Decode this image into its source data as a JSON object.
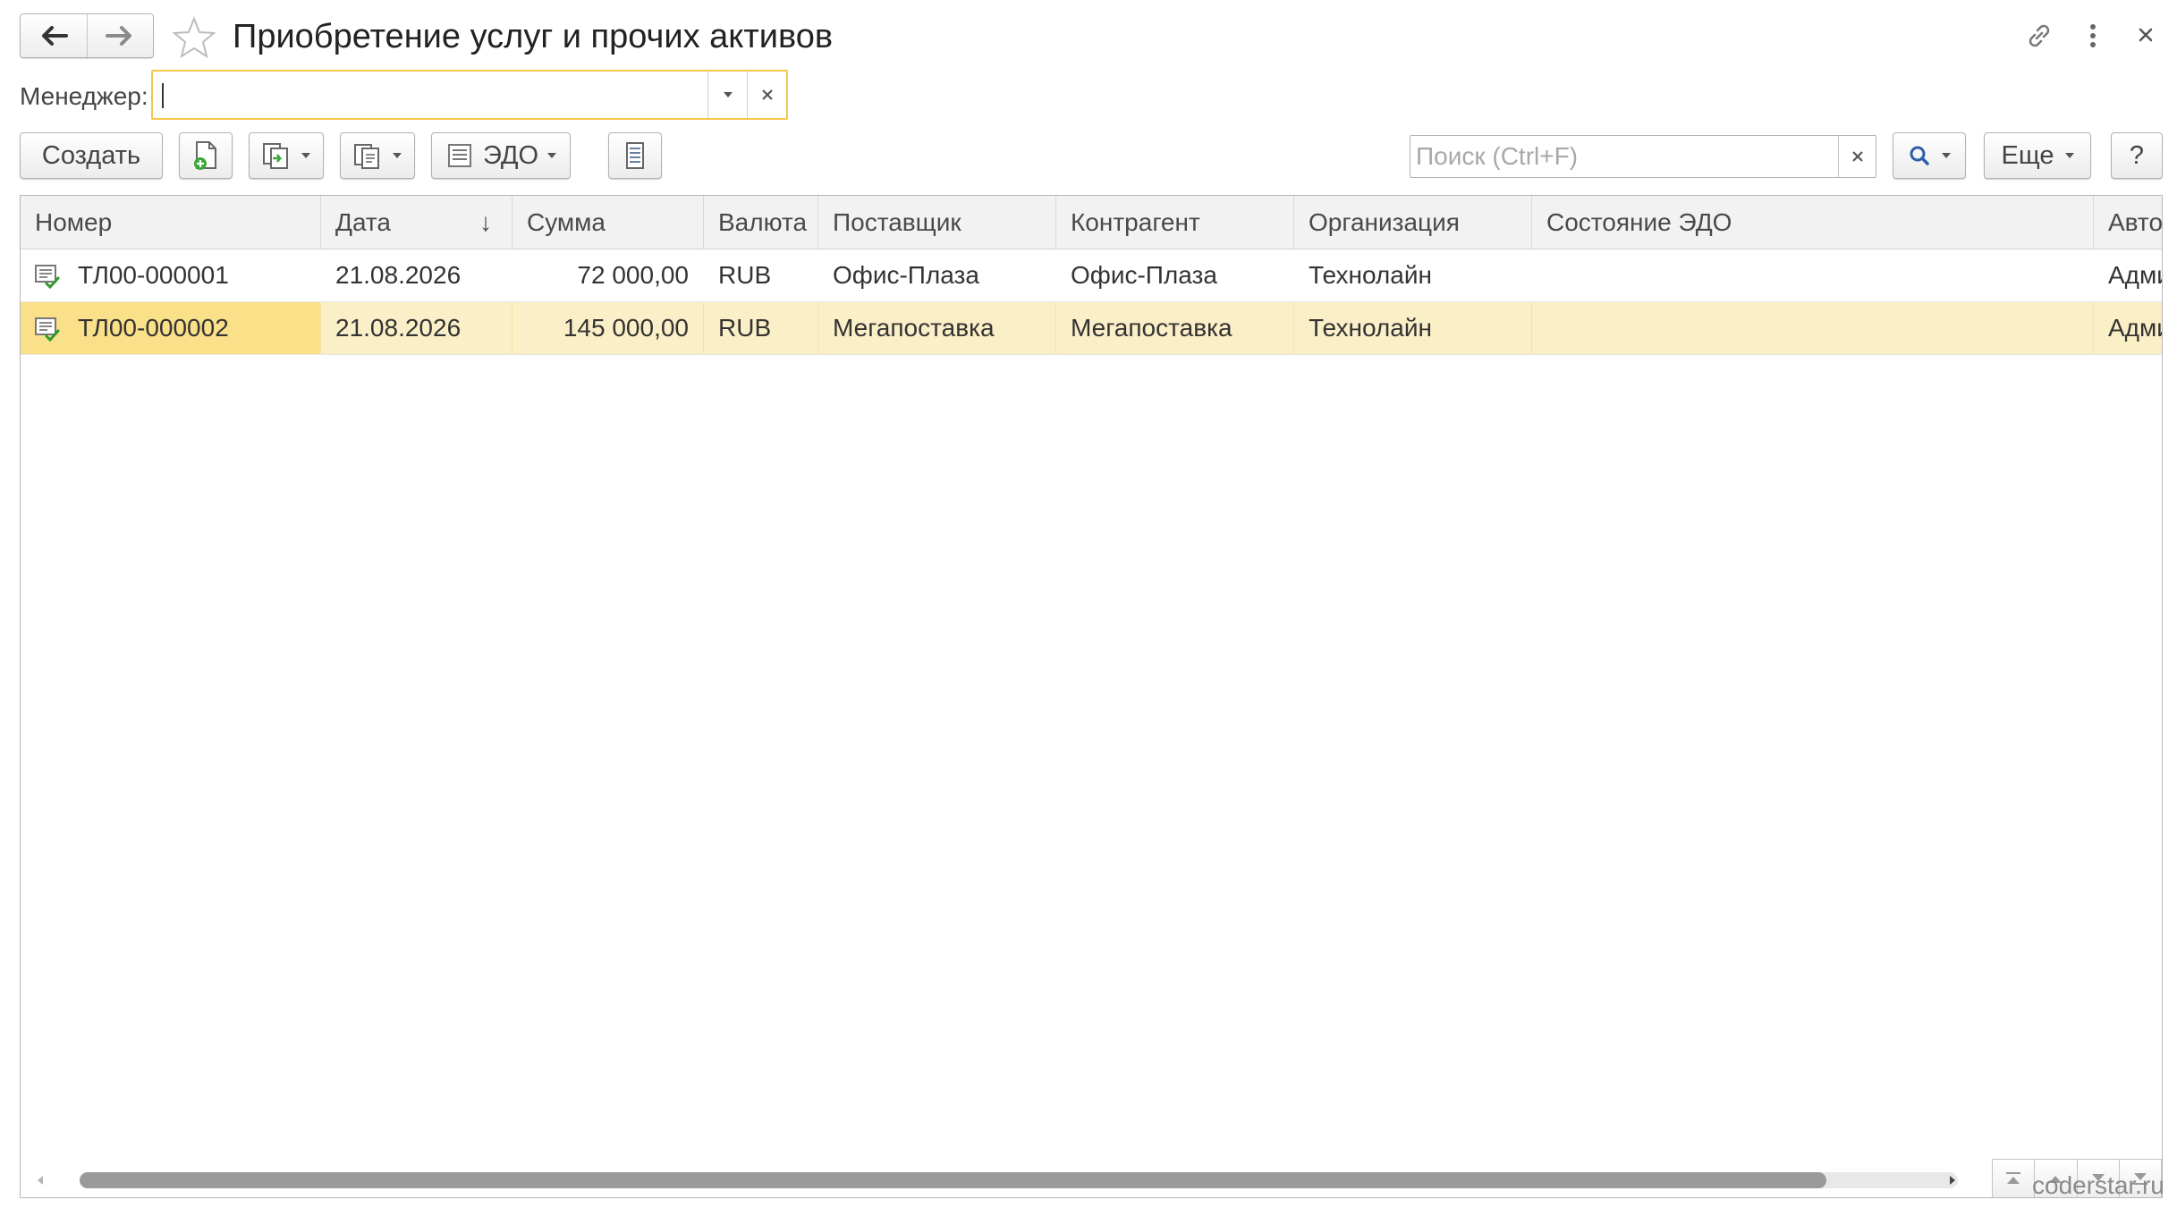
{
  "window": {
    "title": "Приобретение услуг и прочих активов",
    "watermark": "coderstar.ru"
  },
  "filter": {
    "manager_label": "Менеджер:",
    "manager_value": ""
  },
  "toolbar": {
    "create_label": "Создать",
    "edo_label": "ЭДО",
    "search_placeholder": "Поиск (Ctrl+F)",
    "more_label": "Еще",
    "help_label": "?"
  },
  "table": {
    "columns": [
      "Номер",
      "Дата",
      "Сумма",
      "Валюта",
      "Поставщик",
      "Контрагент",
      "Организация",
      "Состояние ЭДО",
      "Автор"
    ],
    "sort_indicator": "↓",
    "rows": [
      {
        "number": "ТЛ00-000001",
        "date": "21.08.2026",
        "sum": "72 000,00",
        "currency": "RUB",
        "supplier": "Офис-Плаза",
        "counterparty": "Офис-Плаза",
        "organization": "Технолайн",
        "edo_state": "",
        "author": "Администратор"
      },
      {
        "number": "ТЛ00-000002",
        "date": "21.08.2026",
        "sum": "145 000,00",
        "currency": "RUB",
        "supplier": "Мегапоставка",
        "counterparty": "Мегапоставка",
        "organization": "Технолайн",
        "edo_state": "",
        "author": "Администратор"
      }
    ],
    "selected_row": 2,
    "horizontal_scroll_fraction": 0.93
  },
  "colors": {
    "selected_row": "#fbefc7",
    "selected_cell": "#fbe08a",
    "focus_border": "#f5c74b"
  }
}
